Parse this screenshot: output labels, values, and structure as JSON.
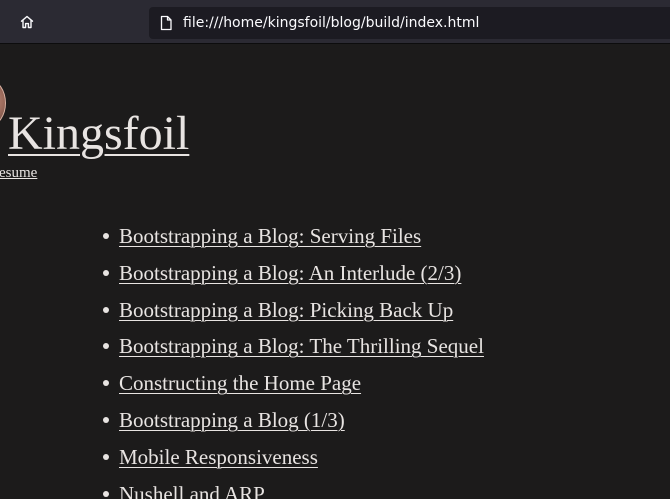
{
  "browser": {
    "url": "file:///home/kingsfoil/blog/build/index.html",
    "home_icon": "home-icon",
    "page_icon": "document-icon"
  },
  "page": {
    "site_title": "Kingsfoil",
    "nav_link": "esume",
    "posts": [
      {
        "title": "Bootstrapping a Blog: Serving Files"
      },
      {
        "title": "Bootstrapping a Blog: An Interlude (2/3)"
      },
      {
        "title": "Bootstrapping a Blog: Picking Back Up"
      },
      {
        "title": "Bootstrapping a Blog: The Thrilling Sequel"
      },
      {
        "title": "Constructing the Home Page"
      },
      {
        "title": "Bootstrapping a Blog (1/3)"
      },
      {
        "title": "Mobile Responsiveness"
      },
      {
        "title": "Nushell and ARP"
      }
    ]
  },
  "colors": {
    "page_background": "#1c1b1b",
    "text": "#e8e4e2",
    "toolbar": "#2b2a33",
    "urlbar": "#1c1b22"
  }
}
